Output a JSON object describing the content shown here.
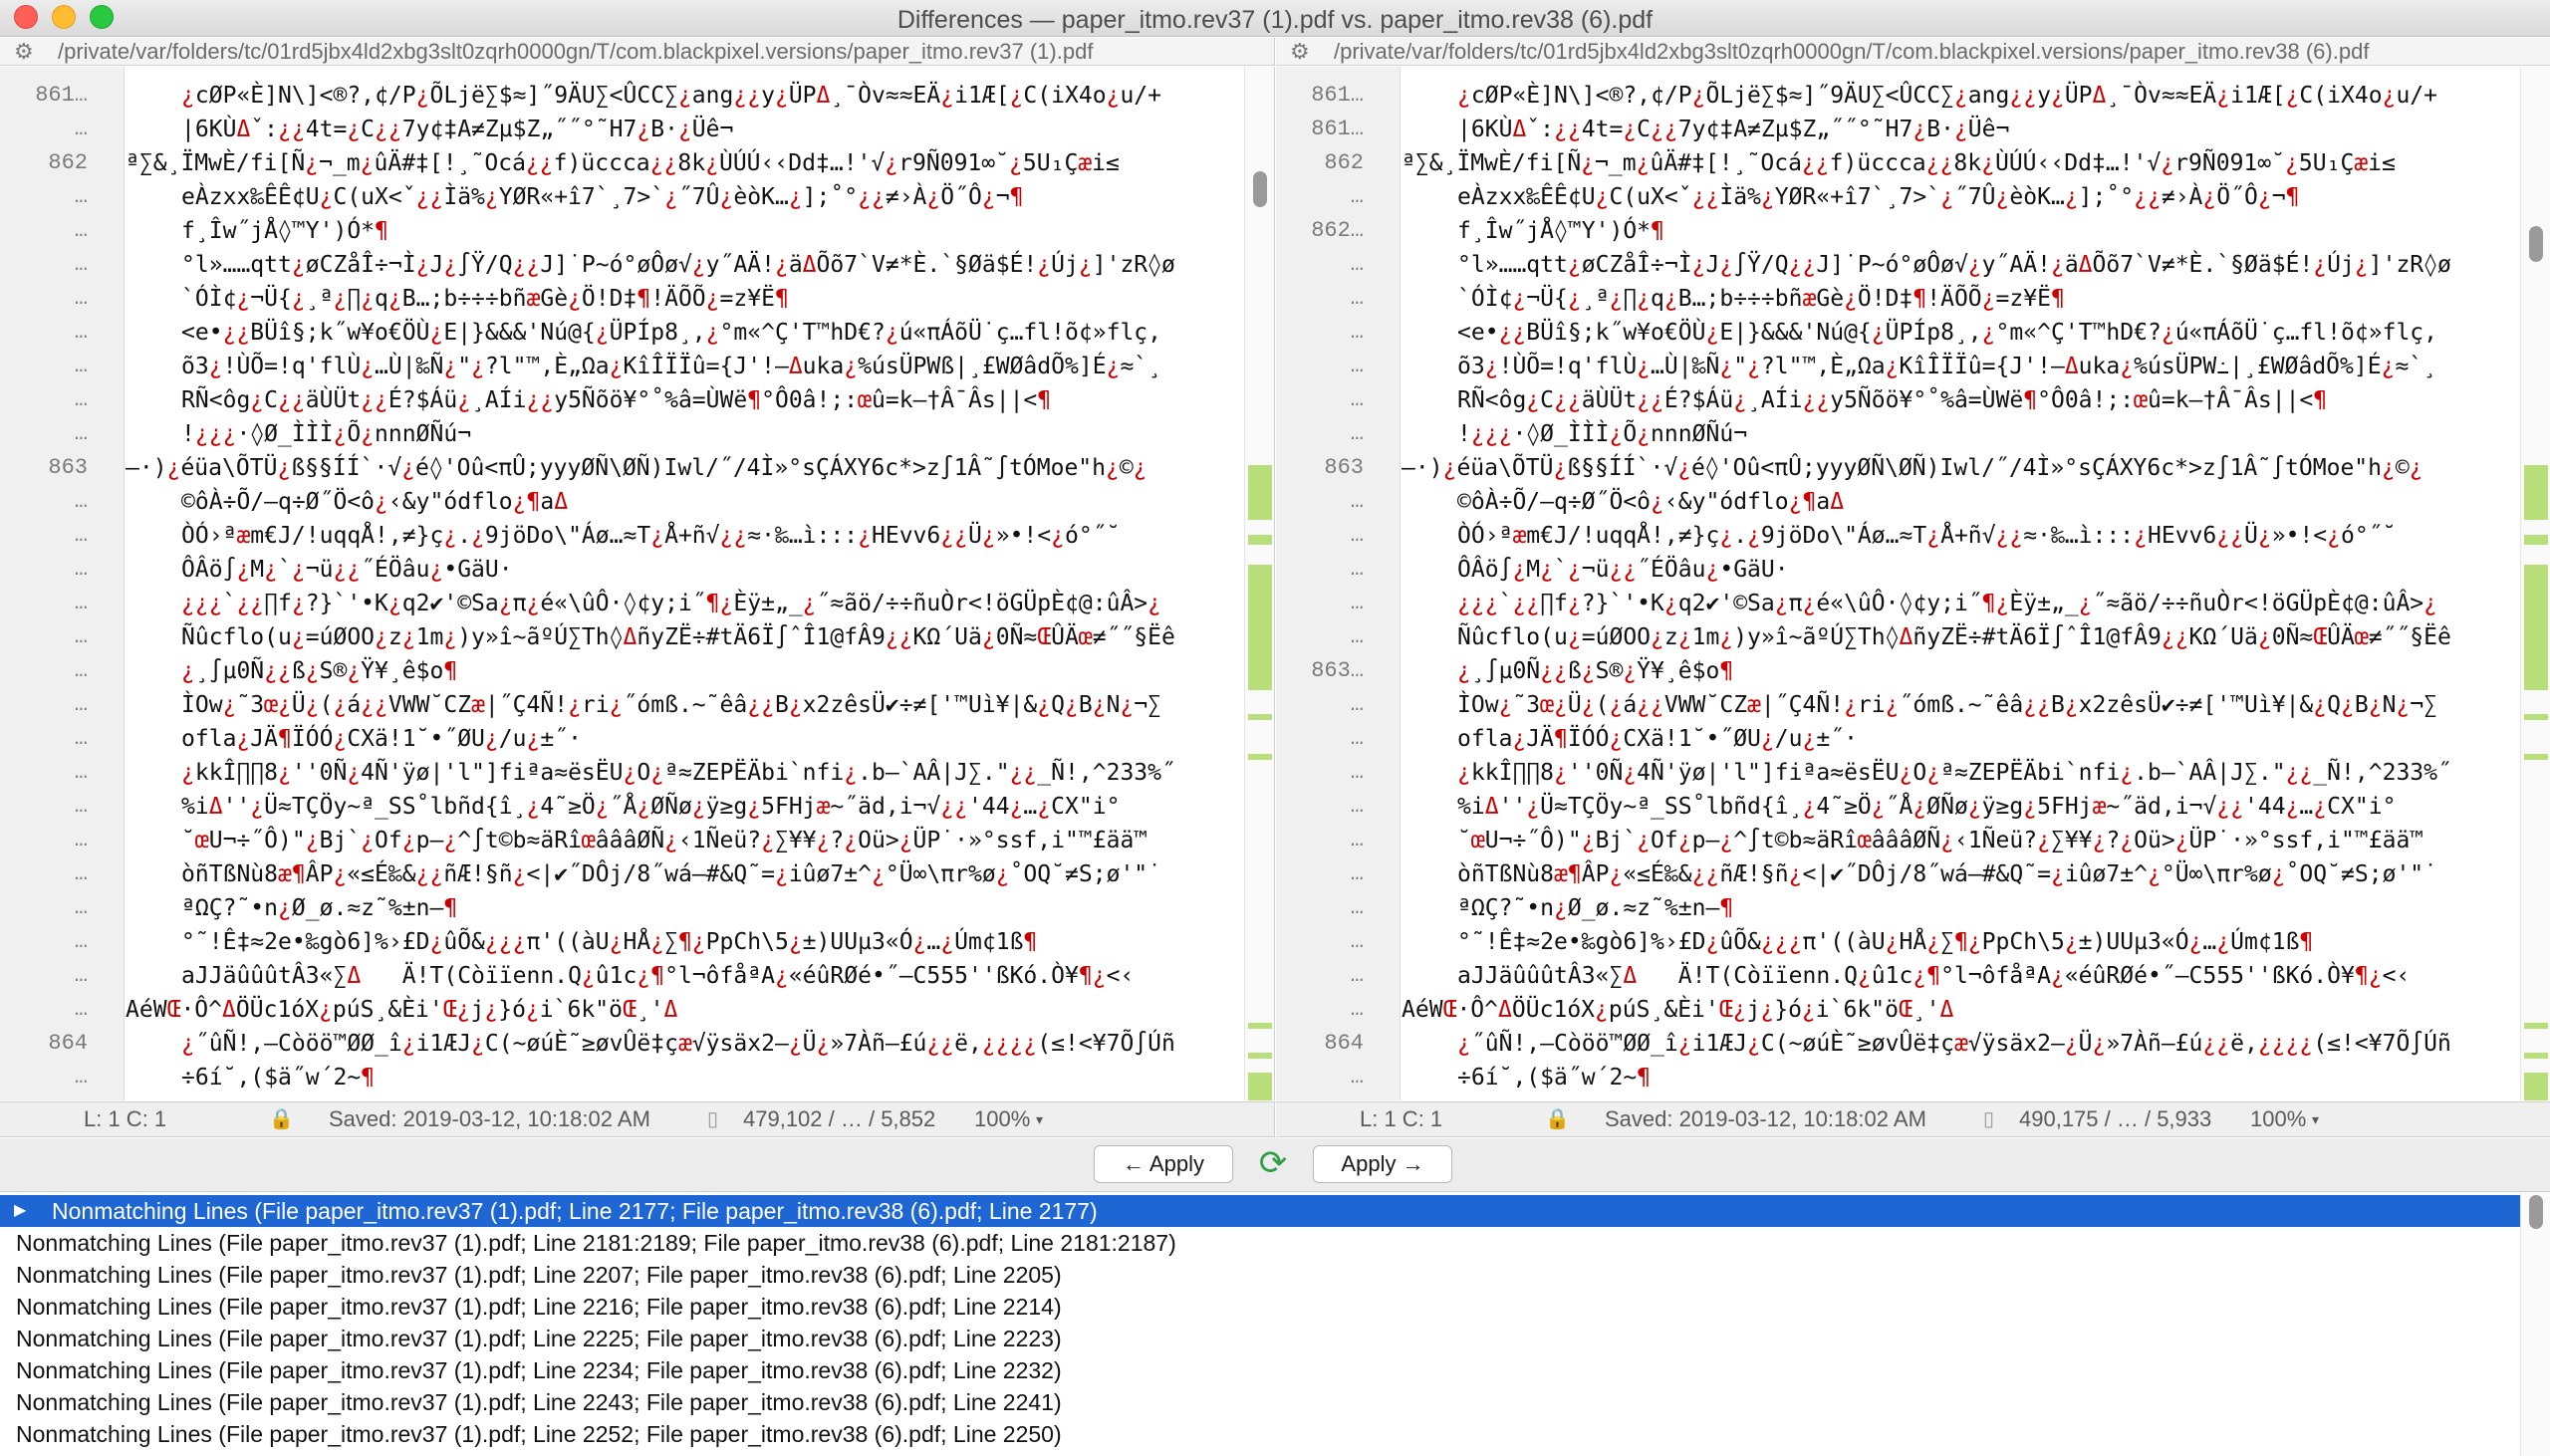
{
  "window": {
    "title": "Differences — paper_itmo.rev37 (1).pdf vs. paper_itmo.rev38 (6).pdf"
  },
  "colors": {
    "selection": "#1e66d3",
    "diff_red": "#cc0000",
    "change_marker": "#b9df7a"
  },
  "left": {
    "path": "/private/var/folders/tc/01rd5jbx4ld2xbg3slt0zqrh0000gn/T/com.blackpixel.versions/paper_itmo.rev37 (1).pdf",
    "gutter": [
      "861…",
      "…",
      "862",
      "…",
      "…",
      "…",
      "…",
      "…",
      "…",
      "…",
      "…",
      "863",
      "…",
      "…",
      "…",
      "…",
      "…",
      "…",
      "…",
      "…",
      "…",
      "…",
      "…",
      "…",
      "…",
      "…",
      "…",
      "…",
      "864",
      "…",
      "…"
    ],
    "lines": [
      "¿cØP«È]N\\]<®?,¢/P¿ÕLjë∑$≈]˝9ÄU∑<ÛCC∑¿ang¿¿y¿ÜPΔ¸¯Òv≈≈EÄ¿i1Æ[¿C(iX4o¿u/+",
      "|6KÙΔˇ:¿¿4t=¿C¿¿7y¢‡A≠Zµ$Z„˝˝°˜H7¿B·¿Üê¬",
      "ª∑&¸ÏMwÈ/fi[Ñ¿¬_m¿ûÄ#‡[!¸˜Ocá¿¿f)ücccа¿¿8k¿ÙÚÚ‹‹Dd‡…!'√¿r9Ñ091∞˘¿5U₁Çæi≤",
      "eÀzxx‰ÊÊ¢U¿C(uX<ˇ¿¿Ìä%¿YØR«+î7`¸7>`¿˝7Û¿èòK…¿];˚°¿¿≠›À¿Ö˝Ô¿¬¶",
      "f¸Îw˝jÅ◊™Y')Ó*¶",
      "°l»……qtt¿øCZåÎ÷¬Ì¿J¿∫Ÿ/Q¿¿J]˙P~ó°øÔø√¿y˝AÄ!¿äΔÕõ7`V≠*È.`§Øä$É!¿Új¿]'zR◊ø",
      "`ÓÌ¢¿¬Ü{¿¸ª¿∏¿q¿B…;b÷÷÷bñæGè¿Ö!D‡¶!ÄÕÕ¿=z¥Ë¶",
      "<e•¿¿BÜî§;k˝w¥o€ÖÙ¿E|}&&&'Nú@{¿ÜPÍp8¸,¿°m«^Ç'T™hD€?¿ú«πÁõÜ˙ç…fl!õ¢»flç,",
      "õ3¿!ÙÕ=!q'flÙ¿…Ù|‰Ñ¿\"¿?l\"™,È„Ωa¿KîÎÏÏû={J'!–Δuka¿%úsÜPWß|¸£WØâdÕ%]É¿≈`¸",
      "RÑ<ôg¿C¿¿äÙÜt¿¿É?$Áü¿¸AÍi¿¿y5Ñõö¥°˚%â=ÙWë¶°Ô0â!;:œû=k–†Â¯Âs||<¶",
      "!¿¿¿·◊Ø_ÌÌÌ¿Õ¿nnnØÑú¬",
      "–·)¿éüa\\ÕTÜ¿ß§§ÍÍ`·√¿é◊'Oû<πÛ;yyyØÑ\\ØÑ)Iwl/˝/4Ì»°sÇÁXY6c*>z∫1Â˜∫tÓMoe\"h¿©¿",
      "©ôÀ÷Õ/–q÷Ø˝Ö<ô¿‹&y\"ódflo¿¶aΔ",
      "ÒÓ›ªæm€J/!uqqÅ!,≠}ç¿.¿9jöDo\\\"Áø…≈T¿Å+ñ√¿¿≈·‰…ì:::¿HEvv6¿¿Ü¿»•!<¿ó°˝˘",
      "ÔÂö∫¿M¿`¿¬ü¿¿˝ÉÖâu¿•GäU·",
      "¿¿¿`¿¿∏f¿?}`'•K¿q2✔'©Sa¿π¿é«\\ûÔ·◊¢y;i˝¶¿Èÿ±„_¿˝≈ãö/÷÷ñuÒr<!öGÜpÈ¢@:ûÂ>¿",
      "Ñûcflo(u¿=úØOO¿z¿1m¿)y»î~ãºÚ∑Th◊ΔñyZË÷#tÄ6Ï∫ˆÎ1@fÂ9¿¿KΩ´Uä¿0Ñ≈ŒÛÄœ≠˝˝§Ëê",
      "¿¸∫µ0Ñ¿¿ß¿S®¿Ÿ¥¸ê$o¶",
      "ÌOw¿˜3œ¿Ü¿(¿á¿¿VWW˘CZæ|˝Ç4Ñ!¿ri¿˝ómß.~˜êâ¿¿B¿x2zêsÜ✔÷≠['™Uì¥|&¿Q¿B¿N¿¬∑",
      "ofla¿JÄ¶ÏÓÓ¿CXä!1˘•˝ØU¿/u¿±˝·",
      "¿kkÎ∏∏8¿''0Ñ¿4Ñ'ÿø|'l\"]fiªa≈ësËU¿O¿ª≈ZEPËÄbi`nfi¿.b–`AÂ|J∑.\"¿¿_Ñ!,^233%˝",
      "%iΔ''¿Ü≈TÇÖy~ª_SS˚lbñd{î¸¿4˜≥Ö¿˝Å¿ØÑø¿ÿ≥g¿5FHjæ~˝äd,i¬√¿¿'44¿…¿CX\"i°",
      "˘œU¬÷˝Ô)\"¿Bj`¿Of¿p–¿^∫t©b≈äRîœâââØÑ¿‹1Ñeü?¿∑¥¥¿?¿Oü>¿ÜP˙·»°ssf,i\"™£ää™",
      "òñTßNù8æ¶ÂP¿«≤É‰&¿¿ñÆ!§ñ¿<|✔˝DÔj/8˝wá–#&Q˜=¿iûø7±^¿°Ü∞\\πr%ø¿˚OQ˘≠S;ø'\"˙",
      "ªΩÇ?˜•n¿Ø_ø.≈z˜%±n–¶",
      "°˜!Ê‡≈2e•‰gò6]%›£D¿ûÕ&¿¿¿π'((àU¿HÅ¿∑¶¿PpCh\\5¿±)UUµ3«Ó¿…¿Úm¢1ß¶",
      "aJJäûûûtÂ3«∑Δ   Ä!T(Còïïenn.Q¿û1c¿¶°l¬ôfåªA¿«éûRØé•˝–C555''ßKó.Ò¥¶¿<‹",
      "AéWŒ·Ô^ΔÖÜc1óX¿púS¸&Èi'Œ¿j¿}ó¿i`6k\"öŒ¸'Δ",
      "¿˝ûÑ!,–Còöö™ØØ_î¿i1ÆJ¿C(~øúÈ˜≥øvÛë‡çæ√ÿsäx2–¿Ü¿»7Àñ–£ú¿¿ë,¿¿¿¿(≤!<¥7Õ∫Úñ",
      "÷6í˘,($ä˝w´2~¶"
    ],
    "status": {
      "pos": "L: 1 C: 1",
      "saved": "Saved: 2019-03-12, 10:18:02 AM",
      "size": "479,102 / … / 5,852",
      "zoom": "100%"
    }
  },
  "right": {
    "path": "/private/var/folders/tc/01rd5jbx4ld2xbg3slt0zqrh0000gn/T/com.blackpixel.versions/paper_itmo.rev38 (6).pdf",
    "gutter": [
      "861…",
      "861…",
      "862",
      "…",
      "862…",
      "…",
      "…",
      "…",
      "…",
      "…",
      "…",
      "863",
      "…",
      "…",
      "…",
      "…",
      "…",
      "863…",
      "…",
      "…",
      "…",
      "…",
      "…",
      "…",
      "…",
      "…",
      "…",
      "…",
      "864",
      "…",
      "…"
    ],
    "lines": [
      "¿cØP«È]N\\]<®?,¢/P¿ÕLjë∑$≈]˝9ÄU∑<ÛCC∑¿ang¿¿y¿ÜPΔ¸¯Òv≈≈EÄ¿i1Æ[¿C(iX4o¿u/+",
      "|6KÙΔˇ:¿¿4t=¿C¿¿7y¢‡A≠Zµ$Z„˝˝°˜H7¿B·¿Üê¬",
      "ª∑&¸ÏMwÈ/fi[Ñ¿¬_m¿ûÄ#‡[!¸˜Ocá¿¿f)ücccа¿¿8k¿ÙÚÚ‹‹Dd‡…!'√¿r9Ñ091∞˘¿5U₁Çæi≤",
      "eÀzxx‰ÊÊ¢U¿C(uX<ˇ¿¿Ìä%¿YØR«+î7`¸7>`¿˝7Û¿èòK…¿];˚°¿¿≠›À¿Ö˝Ô¿¬¶",
      "f¸Îw˝jÅ◊™Y')Ó*¶",
      "°l»……qtt¿øCZåÎ÷¬Ì¿J¿∫Ÿ/Q¿¿J]˙P~ó°øÔø√¿y˝AÄ!¿äΔÕõ7`V≠*È.`§Øä$É!¿Új¿]'zR◊ø",
      "`ÓÌ¢¿¬Ü{¿¸ª¿∏¿q¿B…;b÷÷÷bñæGè¿Ö!D‡¶!ÄÕÕ¿=z¥Ë¶",
      "<e•¿¿BÜî§;k˝w¥o€ÖÙ¿E|}&&&'Nú@{¿ÜPÍp8¸,¿°m«^Ç'T™hD€?¿ú«πÁõÜ˙ç…fl!õ¢»flç,",
      "õ3¿!ÙÕ=!q'flÙ¿…Ù|‰Ñ¿\"¿?l\"™,È„Ωa¿KîÎÏÏû={J'!–Δuka¿%úsÜPW߸|¸£WØâdÕ%]É¿≈`¸",
      "RÑ<ôg¿C¿¿äÙÜt¿¿É?$Áü¿¸AÍi¿¿y5Ñõö¥°˚%â=ÙWë¶°Ô0â!;:œû=k–†Â¯Âs||<¶",
      "!¿¿¿·◊Ø_ÌÌÌ¿Õ¿nnnØÑú¬",
      "–·)¿éüa\\ÕTÜ¿ß§§ÍÍ`·√¿é◊'Oû<πÛ;yyyØÑ\\ØÑ)Iwl/˝/4Ì»°sÇÁXY6c*>z∫1Â˜∫tÓMoe\"h¿©¿",
      "©ôÀ÷Õ/–q÷Ø˝Ö<ô¿‹&y\"ódflo¿¶aΔ",
      "ÒÓ›ªæm€J/!uqqÅ!,≠}ç¿.¿9jöDo\\\"Áø…≈T¿Å+ñ√¿¿≈·‰…ì:::¿HEvv6¿¿Ü¿»•!<¿ó°˝˘",
      "ÔÂö∫¿M¿`¿¬ü¿¿˝ÉÖâu¿•GäU·",
      "¿¿¿`¿¿∏f¿?}`'•K¿q2✔'©Sa¿π¿é«\\ûÔ·◊¢y;i˝¶¿Èÿ±„_¿˝≈ãö/÷÷ñuÒr<!öGÜpÈ¢@:ûÂ>¿",
      "Ñûcflo(u¿=úØOO¿z¿1m¿)y»î~ãºÚ∑Th◊ΔñyZË÷#tÄ6Ï∫ˆÎ1@fÂ9¿¿KΩ´Uä¿0Ñ≈ŒÛÄœ≠˝˝§Ëê",
      "¿¸∫µ0Ñ¿¿ß¿S®¿Ÿ¥¸ê$o¶",
      "ÌOw¿˜3œ¿Ü¿(¿á¿¿VWW˘CZæ|˝Ç4Ñ!¿ri¿˝ómß.~˜êâ¿¿B¿x2zêsÜ✔÷≠['™Uì¥|&¿Q¿B¿N¿¬∑",
      "ofla¿JÄ¶ÏÓÓ¿CXä!1˘•˝ØU¿/u¿±˝·",
      "¿kkÎ∏∏8¿''0Ñ¿4Ñ'ÿø|'l\"]fiªa≈ësËU¿O¿ª≈ZEPËÄbi`nfi¿.b–`AÂ|J∑.\"¿¿_Ñ!,^233%˝",
      "%iΔ''¿Ü≈TÇÖy~ª_SS˚lbñd{î¸¿4˜≥Ö¿˝Å¿ØÑø¿ÿ≥g¿5FHjæ~˝äd,i¬√¿¿'44¿…¿CX\"i°",
      "˘œU¬÷˝Ô)\"¿Bj`¿Of¿p–¿^∫t©b≈äRîœâââØÑ¿‹1Ñeü?¿∑¥¥¿?¿Oü>¿ÜP˙·»°ssf,i\"™£ää™",
      "òñTßNù8æ¶ÂP¿«≤É‰&¿¿ñÆ!§ñ¿<|✔˝DÔj/8˝wá–#&Q˜=¿iûø7±^¿°Ü∞\\πr%ø¿˚OQ˘≠S;ø'\"˙",
      "ªΩÇ?˜•n¿Ø_ø.≈z˜%±n–¶",
      "°˜!Ê‡≈2e•‰gò6]%›£D¿ûÕ&¿¿¿π'((àU¿HÅ¿∑¶¿PpCh\\5¿±)UUµ3«Ó¿…¿Úm¢1ß¶",
      "aJJäûûûtÂ3«∑Δ   Ä!T(Còïïenn.Q¿û1c¿¶°l¬ôfåªA¿«éûRØé•˝–C555''ßKó.Ò¥¶¿<‹",
      "AéWŒ·Ô^ΔÖÜc1óX¿púS¸&Èi'Œ¿j¿}ó¿i`6k\"öŒ¸'Δ",
      "¿˝ûÑ!,–Còöö™ØØ_î¿i1ÆJ¿C(~øúÈ˜≥øvÛë‡çæ√ÿsäx2–¿Ü¿»7Àñ–£ú¿¿ë,¿¿¿¿(≤!<¥7Õ∫Úñ",
      "÷6í˘,($ä˝w´2~¶"
    ],
    "status": {
      "pos": "L: 1 C: 1",
      "saved": "Saved: 2019-03-12, 10:18:02 AM",
      "size": "490,175 / … / 5,933",
      "zoom": "100%"
    }
  },
  "buttons": {
    "apply_left": "← Apply",
    "apply_right": "Apply →"
  },
  "diffs": [
    "Nonmatching Lines (File paper_itmo.rev37 (1).pdf; Line 2177; File paper_itmo.rev38 (6).pdf; Line 2177)",
    "Nonmatching Lines (File paper_itmo.rev37 (1).pdf; Line 2181:2189; File paper_itmo.rev38 (6).pdf; Line 2181:2187)",
    "Nonmatching Lines (File paper_itmo.rev37 (1).pdf; Line 2207; File paper_itmo.rev38 (6).pdf; Line 2205)",
    "Nonmatching Lines (File paper_itmo.rev37 (1).pdf; Line 2216; File paper_itmo.rev38 (6).pdf; Line 2214)",
    "Nonmatching Lines (File paper_itmo.rev37 (1).pdf; Line 2225; File paper_itmo.rev38 (6).pdf; Line 2223)",
    "Nonmatching Lines (File paper_itmo.rev37 (1).pdf; Line 2234; File paper_itmo.rev38 (6).pdf; Line 2232)",
    "Nonmatching Lines (File paper_itmo.rev37 (1).pdf; Line 2243; File paper_itmo.rev38 (6).pdf; Line 2241)",
    "Nonmatching Lines (File paper_itmo.rev37 (1).pdf; Line 2252; File paper_itmo.rev38 (6).pdf; Line 2250)"
  ]
}
